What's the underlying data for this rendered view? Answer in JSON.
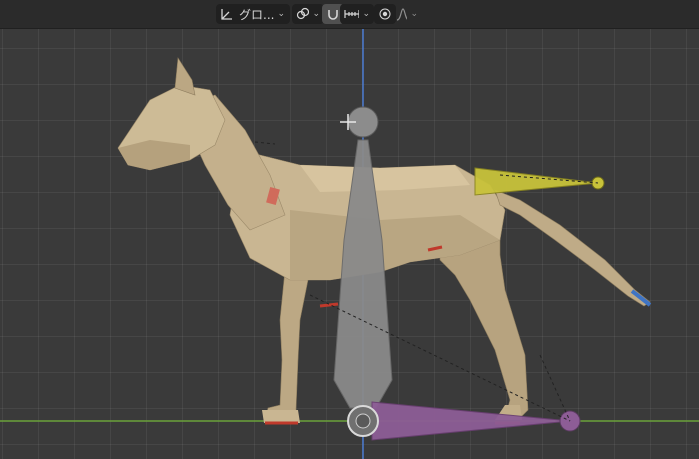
{
  "toolbar": {
    "orientation_label": "グロ...",
    "orientation_icon": "transform-orientation-icon",
    "pivot_icon": "pivot-point-icon",
    "snap_icon": "snap-magnet-icon",
    "snap_target_icon": "snap-increment-icon",
    "proportional_icon": "proportional-edit-icon",
    "falloff_icon": "falloff-curve-icon",
    "chevron_icon": "chevron-down-icon"
  },
  "colors": {
    "viewport_bg": "#3a3a3a",
    "header_bg": "#2b2b2b",
    "dog_body": "#c9b692",
    "y_axis": "#4b7bd1",
    "x_axis": "#6aa23a",
    "tail_bone": "#c8c23a",
    "foot_bone": "#8d5d96",
    "center_bone": "#8a8a8a"
  }
}
